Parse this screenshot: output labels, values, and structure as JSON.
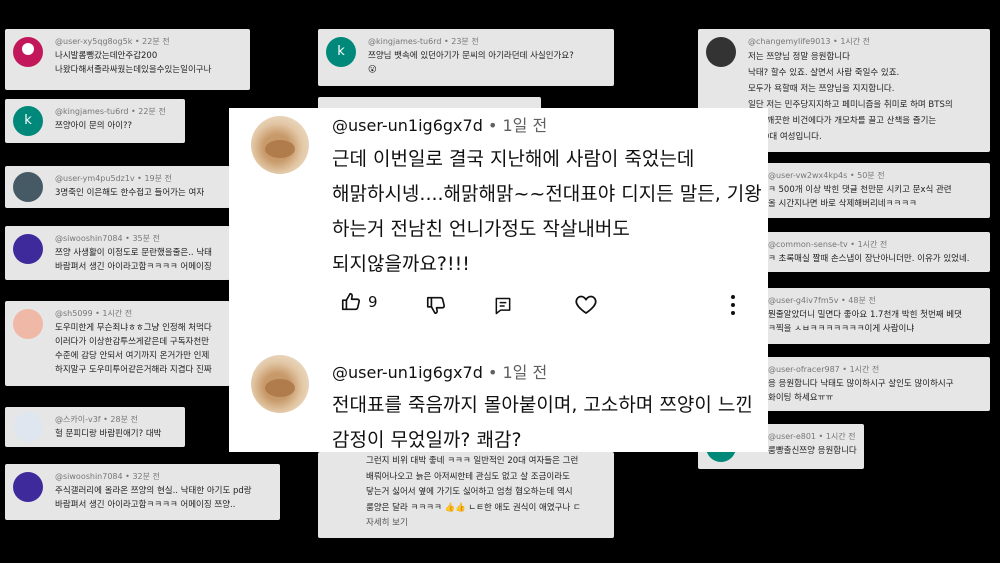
{
  "bg_comments": [
    {
      "user": "@user-xy5qg8og5k",
      "time": "22분 전",
      "lines": [
        "나시발롬뺑갔는데안주갑200",
        "나왔다해서졸라싸웠는데있을수있는일이구나"
      ],
      "avatar": "",
      "avatar_color": "#c2185b"
    },
    {
      "user": "@kingjames-tu6rd",
      "time": "22분 전",
      "lines": [
        "쯔양아이 문의 아이??"
      ],
      "avatar": "k",
      "avatar_color": "#00897b"
    },
    {
      "user": "@user-ym4pu5dz1v",
      "time": "19분 전",
      "lines": [
        "3명죽인 이은해도 한수접고 들어가는  여자"
      ],
      "avatar": "",
      "avatar_color": "#455a64"
    },
    {
      "user": "@siwooshin7084",
      "time": "35분 전",
      "lines": [
        "쯔양 사생활이 이정도로 문란했을줄은.. 낙태",
        "바람펴서 생긴 아이라고함ㅋㅋㅋㅋ 어메이징"
      ],
      "avatar": "",
      "avatar_color": "#3f2a9c"
    },
    {
      "user": "@sh5099",
      "time": "1시간 전",
      "lines": [
        "도우미한게 무슨죄냐ㅎㅎ그냥 인정해 처먹다",
        "이러다가 이상한감투쓰게같은데 구독자천만",
        "수준에 감당 안되서 여기까지 온거가만 인제",
        "하지말구 도우미투어같은거해라 지겹다 진짜"
      ],
      "avatar": "",
      "avatar_color": "#f0b8a6"
    },
    {
      "user": "@스카이-v3f",
      "time": "28분 전",
      "lines": [
        "헐 문피디랑 바람핀애기?  대박"
      ],
      "avatar": "",
      "avatar_color": "#dfe6ef"
    },
    {
      "user": "@siwooshin7084",
      "time": "32분 전",
      "lines": [
        "주식갤러리에 올라온 쯔양의 현실.. 낙태한 아기도 pd랑",
        "바람펴서 생긴 아이라고함ㅋㅋㅋㅋ 어메이징 쯔양.."
      ],
      "avatar": "",
      "avatar_color": "#3f2a9c"
    },
    {
      "user": "@kingjames-tu6rd",
      "time": "23분 전",
      "lines": [
        "쯔양님 뱃속에 있던아기가 문씨의 아기라던데 사실인가요?",
        "😮"
      ],
      "avatar": "k",
      "avatar_color": "#00897b"
    },
    {
      "user": "@changemylife9013",
      "time": "1시간 전",
      "lines": [
        "저는 쯔양님 정말 응원합니다",
        "낙태? 할수 있죠. 살면서 사람 죽일수 있죠.",
        "모두가 욕할때 저는 쯔양님을 지지합니다.",
        "일단 저는 민주당지지하고 페미니즘을 취미로 하며 BTS의",
        "이고 깨끗한 비건에다가 개모차를 끌고 산책을 즐기는",
        "한 20대 여성입니다."
      ],
      "avatar": "",
      "avatar_color": "#333"
    },
    {
      "user": "@user-vw2wx4kp4s",
      "time": "50분 전",
      "lines": [
        "ㅋ 500개 이상 박힌 댓글 천만문 시키고 문x식 관련",
        "올 시간지나면 바로 삭제해버리네ㅋㅋㅋㅋ"
      ],
      "avatar": "",
      "avatar_color": "#777"
    },
    {
      "user": "@common-sense-tv",
      "time": "1시간 전",
      "lines": [
        "ㅋ 초록매실 짤때 손스냅이 장난아니더만. 이유가 있었네."
      ],
      "avatar": "",
      "avatar_color": "#777"
    },
    {
      "user": "@user-g4iv7fm5v",
      "time": "48분 전",
      "lines": [
        "뭔줄알았더니 밀면다 좋아요 1.7천개 박힌 첫번째 베댓",
        "ㅋ찍을 ㅅㅂㅋㅋㅋㅋㅋㅋㅋ이게 사람이냐"
      ],
      "avatar": "",
      "avatar_color": "#777"
    },
    {
      "user": "@user-ofracer987",
      "time": "1시간 전",
      "lines": [
        "응 응원합니다 낙태도 많이하시구 살인도 많이하시구",
        "화이팅 하세요ㅠㅠ"
      ],
      "avatar": "",
      "avatar_color": "#777"
    },
    {
      "user": "@user-e801",
      "time": "1시간 전",
      "lines": [
        "룸빵출신쯔양 응원합니다"
      ],
      "avatar": "",
      "avatar_color": "#00897b"
    },
    {
      "user": "",
      "time": "",
      "lines": [
        "그런지 비위 대박 좋네 ㅋㅋㅋ 일반적인 20대 여자들은 그런",
        "배뤄어나오고 늙은 아저씨한테 관심도 없고 살 조금이라도",
        "닿는거 싫어서 옆에 가기도 싫어하고 엄청 혐오하는데 역시",
        "룸양은 달라 ㅋㅋㅋㅋ 👍👍 ㄴㅌ한 애도 권식이 애였구나 ㄷ",
        "자세히 보기"
      ],
      "avatar": "",
      "avatar_color": "#777"
    },
    {
      "user": "",
      "time": "",
      "lines": [
        ""
      ],
      "avatar": "",
      "avatar_color": "#777"
    }
  ],
  "comments": [
    {
      "user": "@user-un1ig6gx7d",
      "time": "1일 전",
      "lines": [
        "근데 이번일로 결국 지난해에 사람이 죽었는데",
        "해맑하시넹....해맑해맑~~전대표야 디지든 말든, 기왕",
        "하는거 전남친 언니가정도 작살내버도",
        "되지않을까요?!!!"
      ],
      "likes": "9"
    },
    {
      "user": "@user-un1ig6gx7d",
      "time": "1일 전",
      "lines": [
        "전대표를 죽음까지 몰아붙이며, 고소하며 쯔양이 느낀",
        "감정이 무었일까? 쾌감?"
      ]
    }
  ],
  "icons": {
    "like": "thumbs-up-icon",
    "dislike": "thumbs-down-icon",
    "reply": "reply-icon",
    "heart": "heart-icon",
    "more": "more-vert-icon"
  }
}
